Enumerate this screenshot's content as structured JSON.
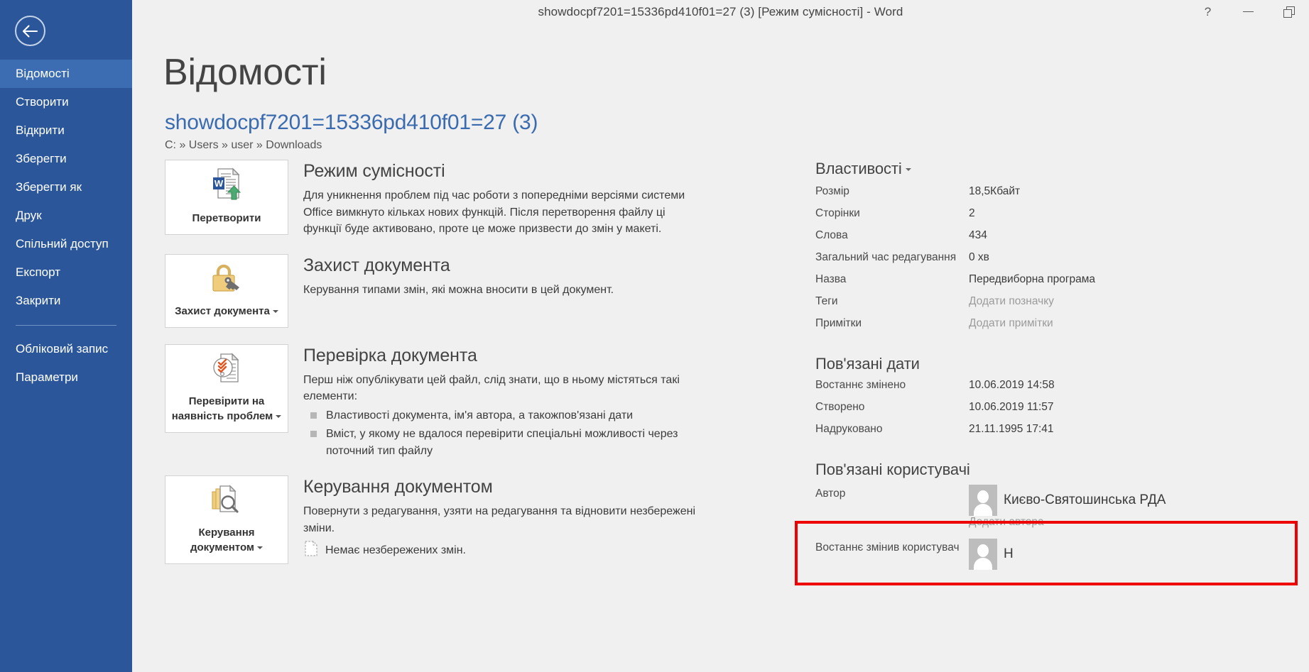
{
  "titlebar": {
    "title": "showdocpf7201=15336pd410f01=27 (3) [Режим сумісності] - Word",
    "help_label": "?",
    "minimize_label": "",
    "restore_label": ""
  },
  "sidebar": {
    "back_label": "",
    "items": [
      {
        "label": "Відомості",
        "active": true
      },
      {
        "label": "Створити",
        "active": false
      },
      {
        "label": "Відкрити",
        "active": false
      },
      {
        "label": "Зберегти",
        "active": false
      },
      {
        "label": "Зберегти як",
        "active": false
      },
      {
        "label": "Друк",
        "active": false
      },
      {
        "label": "Спільний доступ",
        "active": false
      },
      {
        "label": "Експорт",
        "active": false
      },
      {
        "label": "Закрити",
        "active": false
      }
    ],
    "footer_items": [
      {
        "label": "Обліковий запис"
      },
      {
        "label": "Параметри"
      }
    ]
  },
  "main": {
    "page_title": "Відомості",
    "doc_name": "showdocpf7201=15336pd410f01=27 (3)",
    "doc_path": "C: » Users » user » Downloads",
    "cards": [
      {
        "button_label": "Перетворити",
        "has_caret": false,
        "icon": "word-convert-icon",
        "title": "Режим сумісності",
        "desc": "Для уникнення проблем під час роботи з попередніми версіями системи Office вимкнуто кільках нових функцій. Після перетворення файлу ці функції буде активовано, проте це може призвести до змін у макеті."
      },
      {
        "button_label": "Захист документа",
        "has_caret": true,
        "icon": "lock-key-icon",
        "title": "Захист документа",
        "desc": "Керування типами змін, які можна вносити в цей документ."
      },
      {
        "button_label": "Перевірити на наявність проблем",
        "has_caret": true,
        "icon": "inspect-document-icon",
        "title": "Перевірка документа",
        "desc": "Перш ніж опублікувати цей файл, слід знати, що в ньому містяться такі елементи:",
        "bullets": [
          "Властивості документа, ім'я автора, а такожпов'язані дати",
          "Вміст, у якому не вдалося перевірити спеціальні можливості через поточний тип файлу"
        ]
      },
      {
        "button_label": "Керування документом",
        "has_caret": true,
        "icon": "manage-document-icon",
        "title": "Керування документом",
        "desc": "Повернути з редагування, узяти на редагування та відновити незбережені зміни.",
        "note": "Немає незбережених змін.",
        "note_icon": "unsaved-changes-icon"
      }
    ],
    "properties": {
      "heading": "Властивості",
      "rows": [
        {
          "label": "Розмір",
          "value": "18,5Кбайт",
          "placeholder": false
        },
        {
          "label": "Сторінки",
          "value": "2",
          "placeholder": false
        },
        {
          "label": "Слова",
          "value": "434",
          "placeholder": false
        },
        {
          "label": "Загальний час редагування",
          "value": "0 хв",
          "placeholder": false
        },
        {
          "label": "Назва",
          "value": "Передвиборна програма",
          "placeholder": false
        },
        {
          "label": "Теги",
          "value": "Додати позначку",
          "placeholder": true
        },
        {
          "label": "Примітки",
          "value": "Додати примітки",
          "placeholder": true
        }
      ]
    },
    "dates": {
      "heading": "Пов'язані дати",
      "rows": [
        {
          "label": "Востаннє змінено",
          "value": "10.06.2019 14:58"
        },
        {
          "label": "Створено",
          "value": "10.06.2019 11:57"
        },
        {
          "label": "Надруковано",
          "value": "21.11.1995 17:41"
        }
      ]
    },
    "users": {
      "heading": "Пов'язані користувачі",
      "author_label": "Автор",
      "author_name": "Києво-Святошинська РДА",
      "add_author_label": "Додати автора",
      "last_modified_label": "Востаннє змінив користувач",
      "last_modified_name": "Н"
    }
  },
  "annotation": {
    "highlight_color": "#ee0000"
  },
  "colors": {
    "brand_blue": "#2b579a",
    "active_blue": "#3c6db3",
    "link_blue": "#3a6bb0",
    "page_bg": "#f0f0f0"
  }
}
